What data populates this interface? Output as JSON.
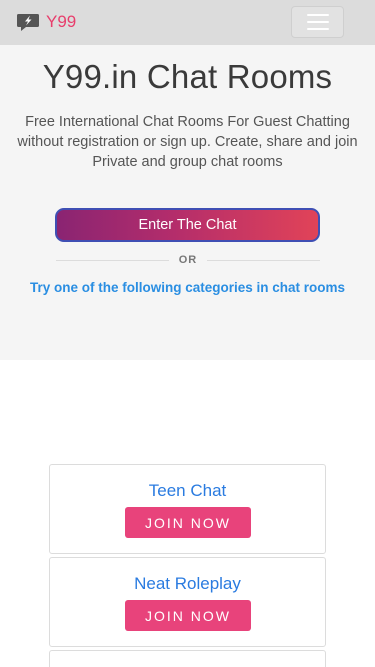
{
  "navbar": {
    "brand": "Y99",
    "logo_icon": "lightning-chat-icon",
    "menu_icon": "hamburger-menu-icon"
  },
  "hero": {
    "title": "Y99.in Chat Rooms",
    "subtitle": "Free International Chat Rooms For Guest Chatting without registration or sign up. Create, share and join Private and group chat rooms",
    "enter_button": "Enter The Chat",
    "or_text": "OR",
    "categories_prompt": "Try one of the following categories in chat rooms"
  },
  "rooms": [
    {
      "name": "Teen Chat",
      "button": "JOIN NOW"
    },
    {
      "name": "Neat Roleplay",
      "button": "JOIN NOW"
    }
  ],
  "colors": {
    "brand": "#e83e6c",
    "link_blue": "#2a8ee2",
    "join_button": "#e8437b",
    "navbar_bg": "#dcdcdc",
    "hero_bg": "#f5f5f5"
  }
}
